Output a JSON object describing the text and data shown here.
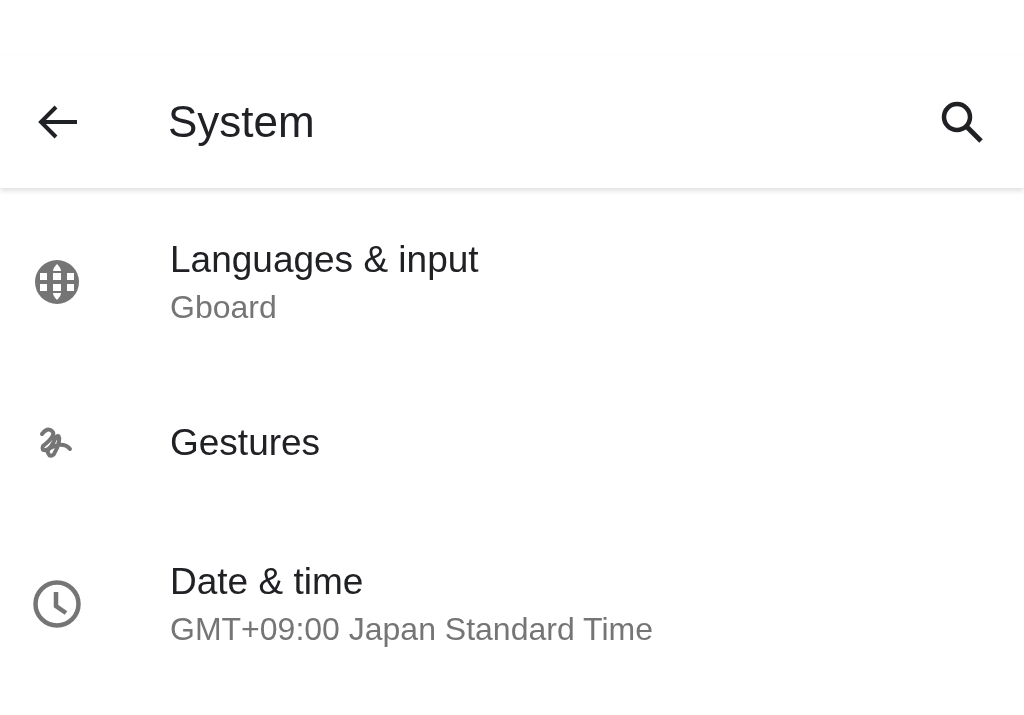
{
  "app_bar": {
    "title": "System"
  },
  "items": [
    {
      "kind": "globe",
      "title": "Languages & input",
      "summary": "Gboard"
    },
    {
      "kind": "squiggle",
      "title": "Gestures"
    },
    {
      "kind": "clock",
      "title": "Date & time",
      "summary": "GMT+09:00 Japan Standard Time"
    }
  ]
}
